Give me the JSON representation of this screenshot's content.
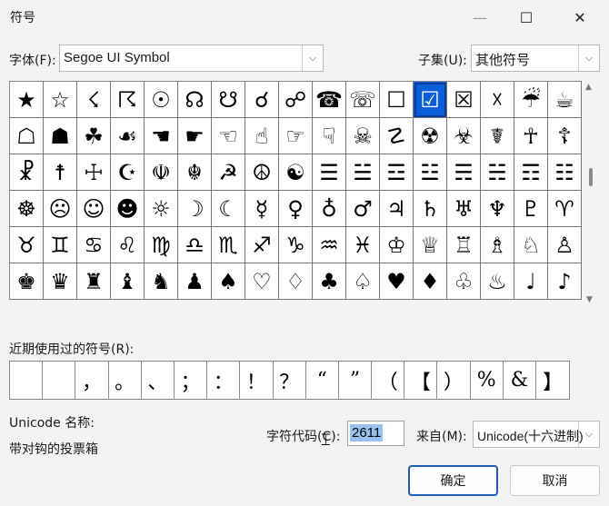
{
  "window": {
    "title": "符号",
    "minimize_icon": "—",
    "maximize_icon": "☐",
    "close_icon": "✕"
  },
  "font": {
    "label": "字体(F):",
    "value": "Segoe UI Symbol"
  },
  "subset": {
    "label": "子集(U):",
    "value": "其他符号"
  },
  "symbols": [
    "★",
    "☆",
    "☇",
    "☈",
    "☉",
    "☊",
    "☋",
    "☌",
    "☍",
    "☎",
    "☏",
    "☐",
    "☑",
    "☒",
    "☓",
    "☔",
    "☕",
    "☖",
    "☗",
    "☘",
    "☙",
    "☚",
    "☛",
    "☜",
    "☝",
    "☞",
    "☟",
    "☠",
    "☡",
    "☢",
    "☣",
    "☤",
    "☥",
    "☦",
    "☧",
    "☨",
    "☩",
    "☪",
    "☫",
    "☬",
    "☭",
    "☮",
    "☯",
    "☰",
    "☱",
    "☲",
    "☳",
    "☴",
    "☵",
    "☶",
    "☷",
    "☸",
    "☹",
    "☺",
    "☻",
    "☼",
    "☽",
    "☾",
    "☿",
    "♀",
    "♁",
    "♂",
    "♃",
    "♄",
    "♅",
    "♆",
    "♇",
    "♈",
    "♉",
    "♊",
    "♋",
    "♌",
    "♍",
    "♎",
    "♏",
    "♐",
    "♑",
    "♒",
    "♓",
    "♔",
    "♕",
    "♖",
    "♗",
    "♘",
    "♙",
    "♚",
    "♛",
    "♜",
    "♝",
    "♞",
    "♟",
    "♠",
    "♡",
    "♢",
    "♣",
    "♤",
    "♥",
    "♦",
    "♧",
    "♨",
    "♩",
    "♪"
  ],
  "selected_symbol": "☑",
  "recent": {
    "label": "近期使用过的符号(R):",
    "items": [
      "",
      "",
      "，",
      "。",
      "、",
      "；",
      "：",
      "！",
      "？",
      "“",
      "”",
      "（",
      "【",
      "）",
      "%",
      "&",
      "】"
    ]
  },
  "unicode_name": {
    "label": "Unicode 名称:",
    "value": "带对钩的投票箱"
  },
  "char_code": {
    "label": "字符代码(C):",
    "value": "2611"
  },
  "from": {
    "label": "来自(M):",
    "value": "Unicode(十六进制)"
  },
  "buttons": {
    "ok": "确定",
    "cancel": "取消"
  },
  "icons": {
    "dropdown": "chevron-down-icon",
    "scroll_up": "triangle-up-icon",
    "scroll_down": "triangle-down-icon",
    "cursor": "text-cursor-icon"
  },
  "colors": {
    "selection": "#0a5fd9",
    "primary_border": "#1f5eb8"
  }
}
